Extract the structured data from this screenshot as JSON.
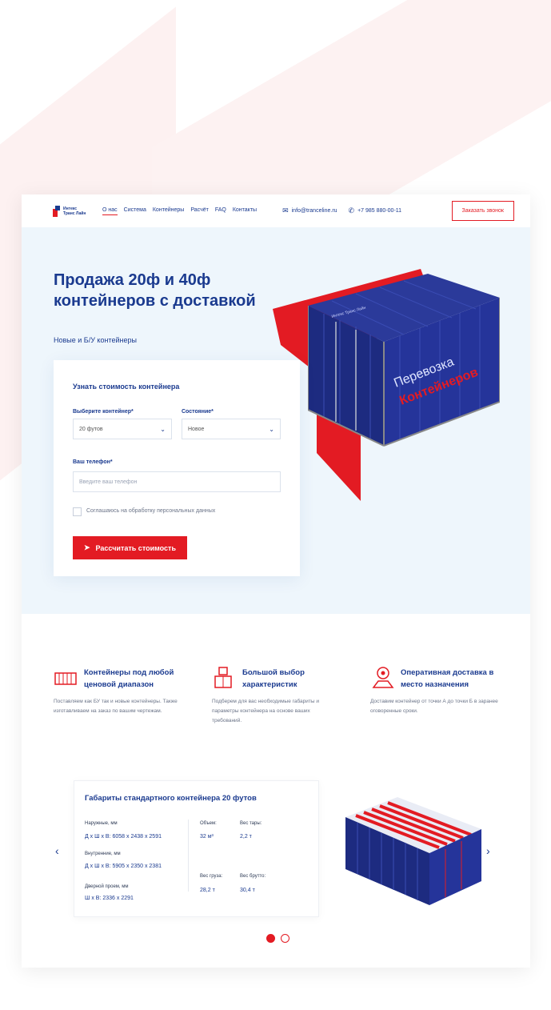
{
  "brand": {
    "line1": "Интекс",
    "line2": "Транс Лайн"
  },
  "nav": [
    {
      "label": "О нас"
    },
    {
      "label": "Система"
    },
    {
      "label": "Контейнеры"
    },
    {
      "label": "Расчёт"
    },
    {
      "label": "FAQ"
    },
    {
      "label": "Контакты"
    }
  ],
  "contacts": {
    "email": "info@tranceline.ru",
    "phone": "+7 985 880-00-11"
  },
  "header": {
    "call_button": "Заказать звонок"
  },
  "hero": {
    "title": "Продажа 20ф и 40ф контейнеров с доставкой",
    "subtitle": "Новые и Б/У контейнеры",
    "container_text_1": "Перевозка",
    "container_text_2": "Контейнеров",
    "container_brand": "Интекс Транс Лайн"
  },
  "form": {
    "title": "Узнать стоимость контейнера",
    "container_label": "Выберите контейнер*",
    "container_value": "20 футов",
    "state_label": "Состояние*",
    "state_value": "Новое",
    "phone_label": "Ваш телефон*",
    "phone_placeholder": "Введите ваш телефон",
    "consent": "Соглашаюсь на обработку персональных данных",
    "submit": "Рассчитать стоимость"
  },
  "features": [
    {
      "title": "Контейнеры под любой ценовой диапазон",
      "text": "Поставляем как БУ так и новые контейнеры. Также изготавливаем на заказ по вашим чертежам."
    },
    {
      "title": "Большой выбор характеристик",
      "text": "Подберем для вас необходимые габариты и параметры контейнера на основе ваших требований."
    },
    {
      "title": "Оперативная доставка в место назначения",
      "text": "Доставим контейнер от точки А до точки Б в заранее оговоренные сроки."
    }
  ],
  "dimensions": {
    "title": "Габариты стандартного контейнера 20 футов",
    "outer_label": "Наружные, мм",
    "outer_value": "Д х Ш х В: 6058 х 2438 х 2591",
    "inner_label": "Внутренние, мм",
    "inner_value": "Д х Ш х В: 5905 х 2350 х 2381",
    "door_label": "Дверной проем, мм",
    "door_value": "Ш х В: 2336 х 2291",
    "volume_label": "Объем:",
    "volume_value": "32 м³",
    "tare_label": "Вес тары:",
    "tare_value": "2,2 т",
    "cargo_label": "Вес груза:",
    "cargo_value": "28,2 т",
    "gross_label": "Вес брутто:",
    "gross_value": "30,4 т"
  },
  "slider": {
    "prev": "‹",
    "next": "›"
  },
  "colors": {
    "primary": "#1a3a8f",
    "accent": "#e31b23",
    "hero_bg": "#eef6fc"
  }
}
